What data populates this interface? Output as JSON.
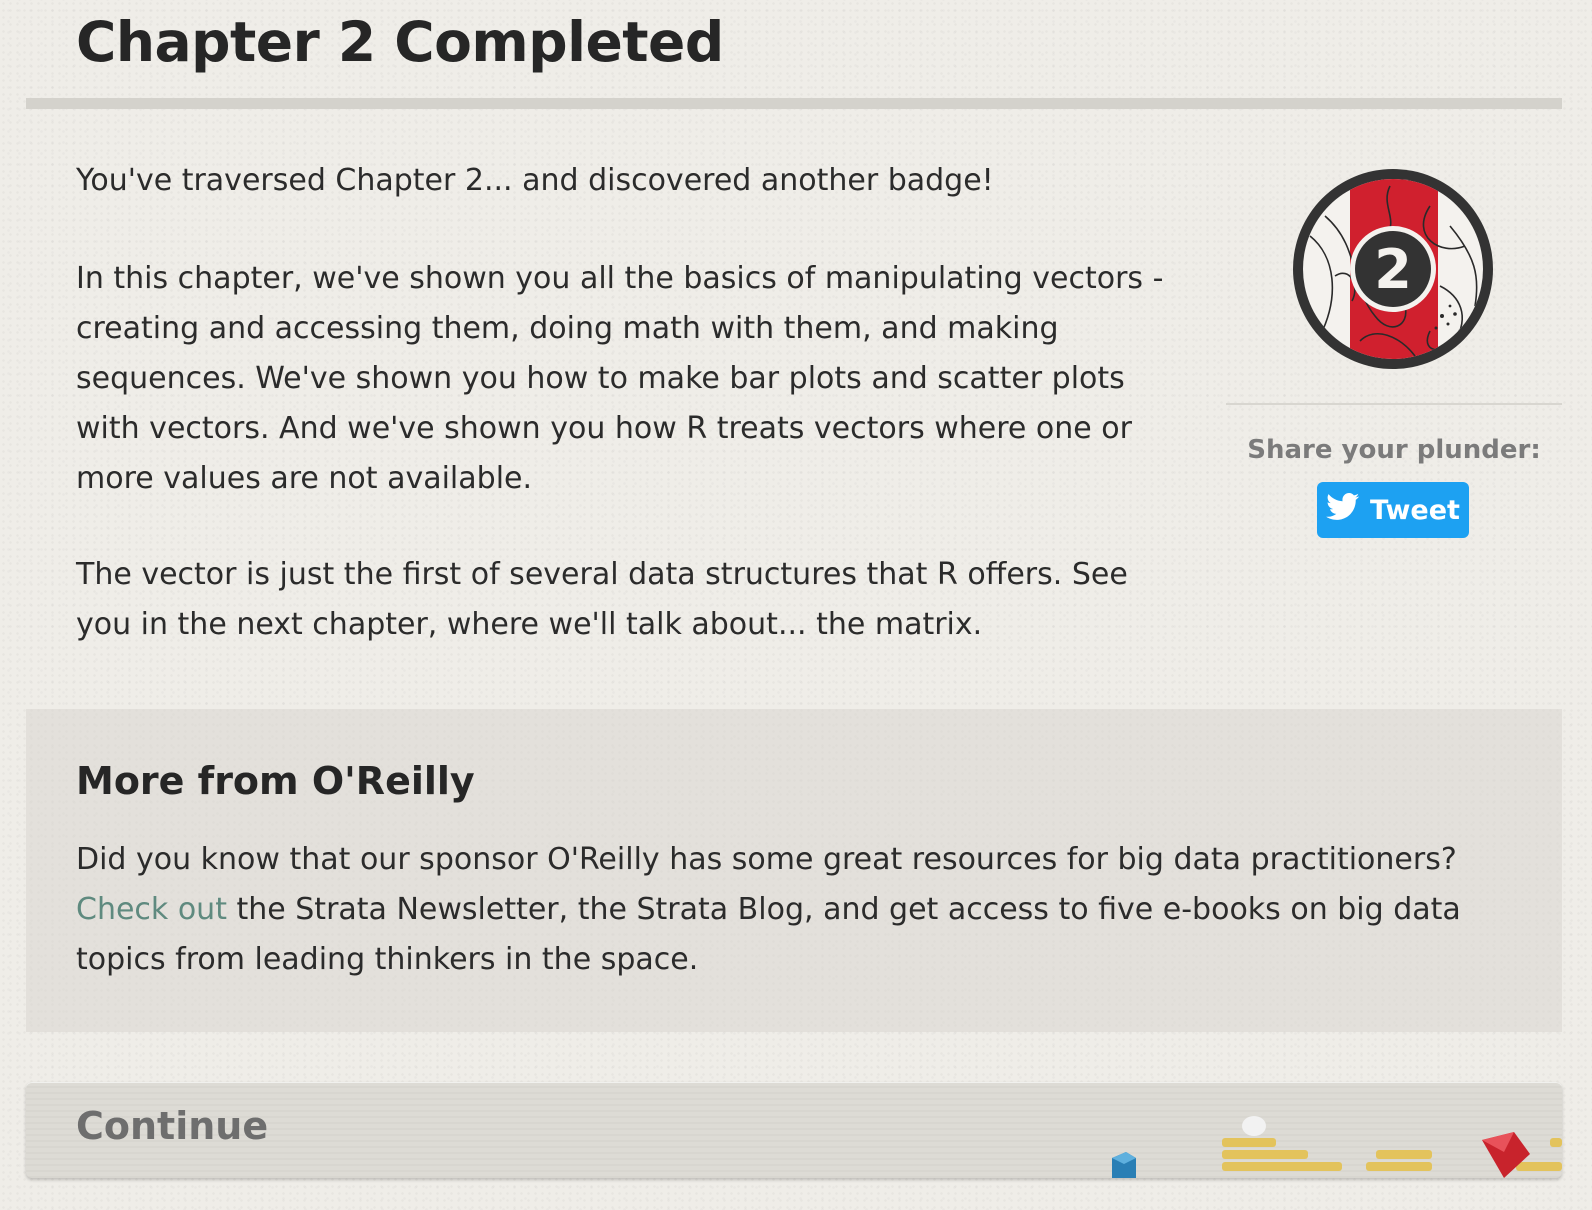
{
  "header": {
    "title": "Chapter 2 Completed"
  },
  "intro": {
    "lead": "You've traversed Chapter 2... and discovered another badge!",
    "summary": "In this chapter, we've shown you all the basics of manipulating vectors - creating and accessing them, doing math with them, and making sequences. We've shown you how to make bar plots and scatter plots with vectors. And we've shown you how R treats vectors where one or more values are not available.",
    "next": "The vector is just the first of several data structures that R offers. See you in the next chapter, where we'll talk about... the matrix."
  },
  "badge": {
    "number": "2",
    "accent": "#d0202e",
    "ring": "#333333"
  },
  "share": {
    "label": "Share your plunder:",
    "tweet_label": "Tweet",
    "tweet_color": "#1da1f2"
  },
  "oreilly": {
    "heading": "More from O'Reilly",
    "text_before": "Did you know that our sponsor O'Reilly has some great resources for big data practitioners? ",
    "link": "Check out",
    "text_after": " the Strata Newsletter, the Strata Blog, and get access to five e-books on big data topics from leading thinkers in the space."
  },
  "continue": {
    "label": "Continue"
  },
  "icons": [
    "twitter-bird-icon",
    "chapter-badge-icon",
    "treasure-gems-icon"
  ]
}
